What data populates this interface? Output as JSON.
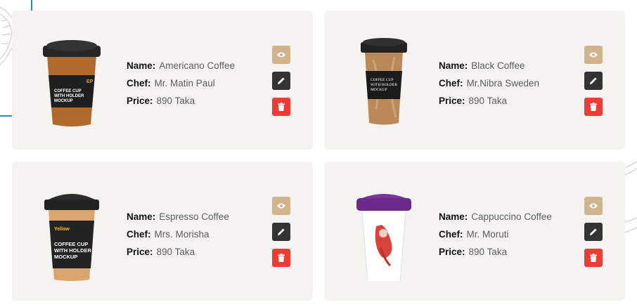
{
  "labels": {
    "name": "Name:",
    "chef": "Chef:",
    "price": "Price:"
  },
  "coffees": [
    {
      "name": "Americano Coffee",
      "chef": "Mr. Matin Paul",
      "price": "890 Taka",
      "cup_text": [
        "COFFEE CUP",
        "WITH HOLDER",
        "MOCKUP"
      ],
      "cup_logo": "EP"
    },
    {
      "name": "Black Coffee",
      "chef": "Mr.Nibra Sweden",
      "price": "890 Taka",
      "cup_text": [
        "COFFEE CUP",
        "WITH HOLDER",
        "MOCKUP"
      ]
    },
    {
      "name": "Espresso Coffee",
      "chef": "Mrs. Morisha",
      "price": "890 Taka",
      "cup_text": [
        "COFFEE CUP",
        "WITH HOLDER",
        "MOCKUP"
      ],
      "cup_brand": "Yellow"
    },
    {
      "name": "Cappuccino Coffee",
      "chef": "Mr. Moruti",
      "price": "890 Taka"
    }
  ],
  "colors": {
    "card_bg": "#f4f3f0",
    "view_button": "#d2b48c",
    "edit_button": "#333333",
    "delete_button": "#ee3c35",
    "frame_accent": "#2f86c9"
  },
  "icons": {
    "view": "eye-icon",
    "edit": "pencil-icon",
    "delete": "trash-icon"
  }
}
